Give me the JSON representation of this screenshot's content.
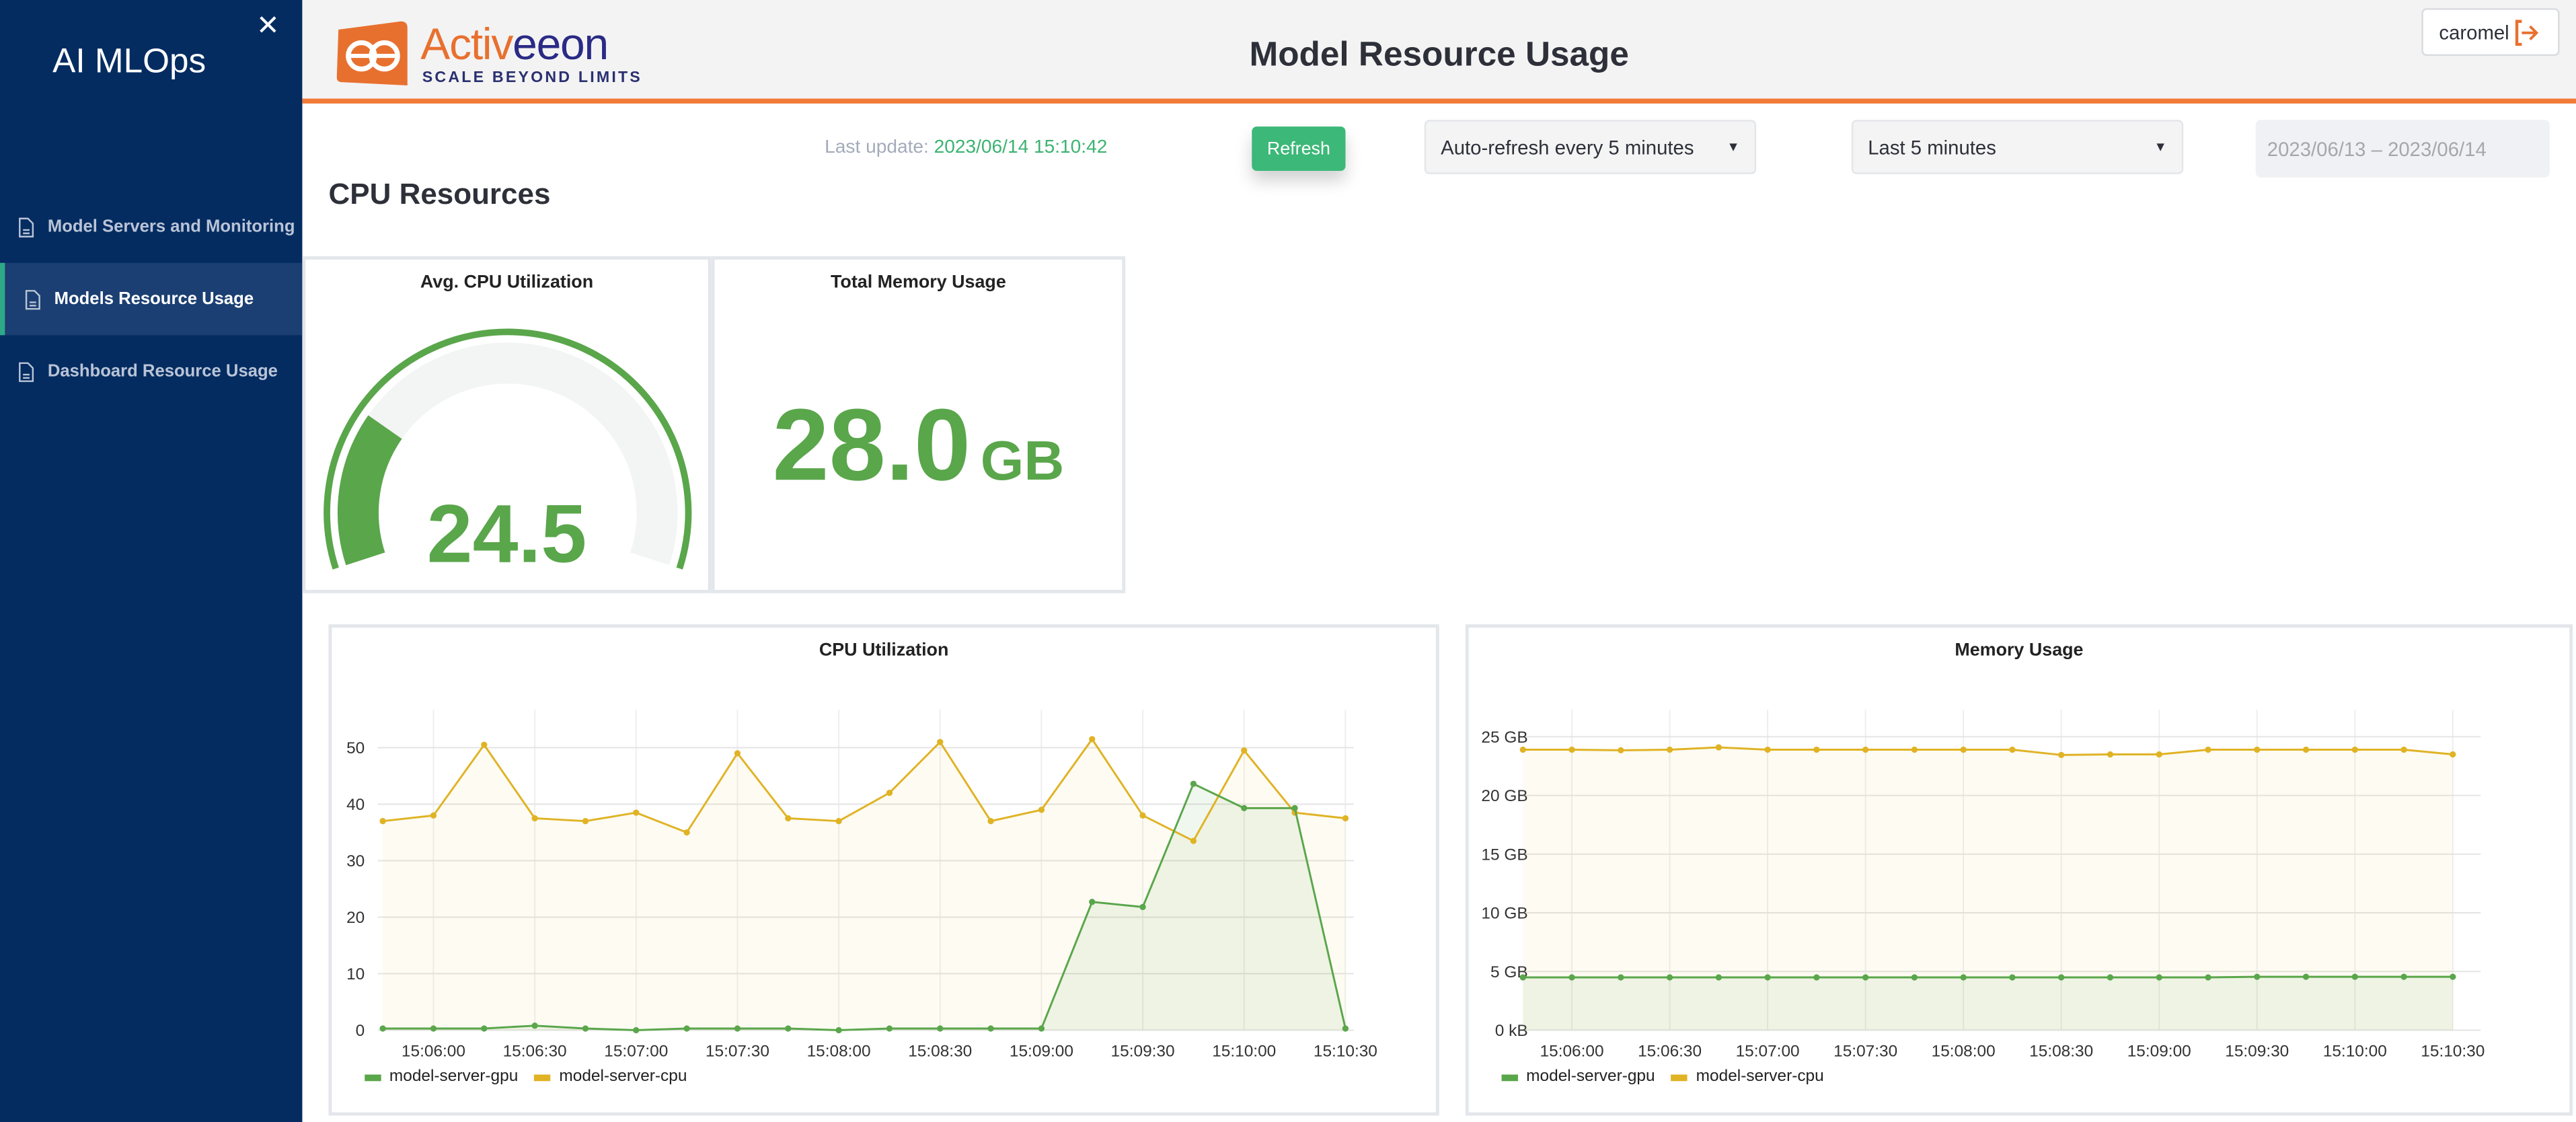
{
  "sidebar": {
    "title": "AI MLOps",
    "close_icon": "close-icon",
    "items": [
      {
        "label": "Model Servers and Monitoring",
        "icon": "document-icon",
        "active": false
      },
      {
        "label": "Models Resource Usage",
        "icon": "document-icon",
        "active": true
      },
      {
        "label": "Dashboard Resource Usage",
        "icon": "document-icon",
        "active": false
      }
    ]
  },
  "header": {
    "title": "Model Resource Usage",
    "logo": {
      "brand_part1": "Activ",
      "brand_part2": "eeon",
      "tagline": "SCALE BEYOND LIMITS"
    },
    "user": {
      "name": "caromel",
      "icon": "logout-icon"
    }
  },
  "toolbar": {
    "last_update_label": "Last update: ",
    "last_update_value": "2023/06/14 15:10:42",
    "refresh_label": "Refresh",
    "auto_refresh_selected": "Auto-refresh every 5 minutes",
    "range_selected": "Last 5 minutes",
    "date_range": "2023/06/13 – 2023/06/14"
  },
  "section_title": "CPU Resources",
  "colors": {
    "gpu": "#5aa64b",
    "cpu": "#e0b325",
    "accent": "#f27a38",
    "sidebar": "#052c61"
  },
  "gauge": {
    "title": "Avg. CPU Utilization",
    "value": "24.5",
    "level": 24.5,
    "min": 0,
    "max": 100
  },
  "memory_stat": {
    "title": "Total Memory Usage",
    "value": "28.0",
    "unit": "GB"
  },
  "chart_data": [
    {
      "type": "line",
      "title": "CPU Utilization",
      "x": [
        "15:05:45",
        "15:06:00",
        "15:06:15",
        "15:06:30",
        "15:06:45",
        "15:07:00",
        "15:07:15",
        "15:07:30",
        "15:07:45",
        "15:08:00",
        "15:08:15",
        "15:08:30",
        "15:08:45",
        "15:09:00",
        "15:09:15",
        "15:09:30",
        "15:09:45",
        "15:10:00",
        "15:10:15",
        "15:10:30"
      ],
      "x_ticks": [
        "15:06:00",
        "15:06:30",
        "15:07:00",
        "15:07:30",
        "15:08:00",
        "15:08:30",
        "15:09:00",
        "15:09:30",
        "15:10:00",
        "15:10:30"
      ],
      "y_ticks": [
        0,
        10,
        20,
        30,
        40,
        50
      ],
      "y_tick_labels": [
        "0",
        "10",
        "20",
        "30",
        "40",
        "50"
      ],
      "ylim": [
        0,
        56.7
      ],
      "grid": true,
      "area_fill": true,
      "legend_position": "bottom-left",
      "series": [
        {
          "name": "model-server-gpu",
          "color": "#5aa64b",
          "values": [
            0.3,
            0.3,
            0.3,
            0.8,
            0.3,
            0,
            0.3,
            0.3,
            0.3,
            0,
            0.3,
            0.3,
            0.3,
            0.3,
            22.7,
            21.8,
            43.6,
            39.3,
            39.3,
            0.3
          ]
        },
        {
          "name": "model-server-cpu",
          "color": "#e0b325",
          "values": [
            37,
            38,
            50.5,
            37.5,
            37,
            38.5,
            35,
            49,
            37.5,
            37,
            42,
            51,
            37,
            39,
            51.5,
            38,
            33.5,
            49.5,
            38.5,
            37.5
          ]
        }
      ]
    },
    {
      "type": "line",
      "title": "Memory Usage",
      "x": [
        "15:05:45",
        "15:06:00",
        "15:06:15",
        "15:06:30",
        "15:06:45",
        "15:07:00",
        "15:07:15",
        "15:07:30",
        "15:07:45",
        "15:08:00",
        "15:08:15",
        "15:08:30",
        "15:08:45",
        "15:09:00",
        "15:09:15",
        "15:09:30",
        "15:09:45",
        "15:10:00",
        "15:10:15",
        "15:10:30"
      ],
      "x_ticks": [
        "15:06:00",
        "15:06:30",
        "15:07:00",
        "15:07:30",
        "15:08:00",
        "15:08:30",
        "15:09:00",
        "15:09:30",
        "15:10:00",
        "15:10:30"
      ],
      "y_ticks": [
        0,
        5,
        10,
        15,
        20,
        25
      ],
      "y_tick_labels": [
        "0 kB",
        "5 GB",
        "10 GB",
        "15 GB",
        "20 GB",
        "25 GB"
      ],
      "ylim": [
        0,
        27.3
      ],
      "yunit": "GB",
      "grid": true,
      "area_fill": true,
      "legend_position": "bottom-left",
      "series": [
        {
          "name": "model-server-gpu",
          "color": "#5aa64b",
          "values": [
            4.5,
            4.5,
            4.5,
            4.5,
            4.5,
            4.5,
            4.5,
            4.5,
            4.5,
            4.5,
            4.5,
            4.5,
            4.5,
            4.5,
            4.5,
            4.55,
            4.55,
            4.55,
            4.55,
            4.55
          ]
        },
        {
          "name": "model-server-cpu",
          "color": "#e0b325",
          "values": [
            23.9,
            23.9,
            23.85,
            23.9,
            24.1,
            23.9,
            23.9,
            23.9,
            23.9,
            23.9,
            23.9,
            23.45,
            23.5,
            23.5,
            23.9,
            23.9,
            23.9,
            23.9,
            23.9,
            23.5
          ]
        }
      ]
    }
  ]
}
